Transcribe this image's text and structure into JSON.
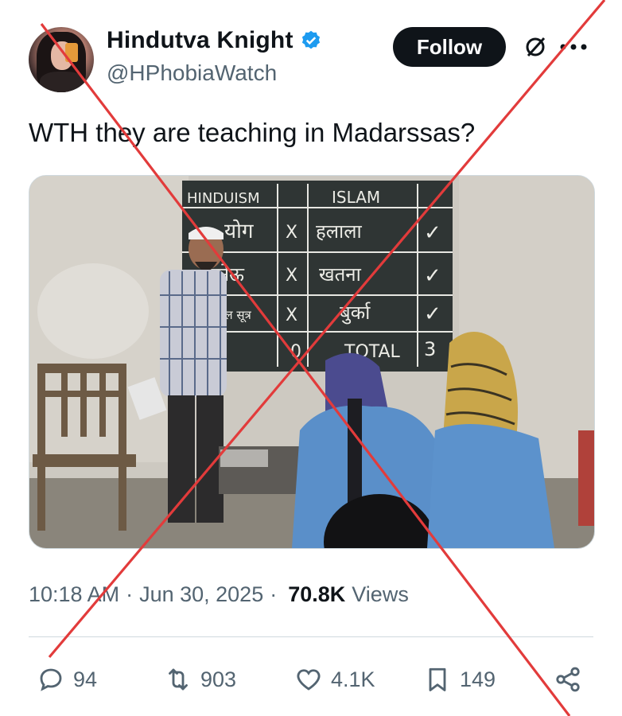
{
  "author": {
    "display_name": "Hindutva Knight",
    "handle": "@HPhobiaWatch",
    "verified": true,
    "verified_color": "#1d9bf0"
  },
  "header": {
    "follow_label": "Follow",
    "icons": [
      "grok-icon",
      "more-icon"
    ]
  },
  "tweet": {
    "text": "WTH they are teaching in Madarssas?"
  },
  "media": {
    "board": {
      "col_left": "HINDUISM",
      "col_right": "ISLAM",
      "rows": [
        {
          "left": "योग",
          "mark_left": "X",
          "right": "हलाला",
          "mark_right": "✓"
        },
        {
          "left": "जनेऊ",
          "mark_left": "X",
          "right": "खतना",
          "mark_right": "✓"
        },
        {
          "left": "मंगल सूत्र",
          "mark_left": "X",
          "right": "बुर्का",
          "mark_right": "✓"
        }
      ],
      "total_left": "0",
      "total_label": "TOTAL",
      "total_right": "3"
    }
  },
  "meta": {
    "time": "10:18 AM",
    "sep1": "·",
    "date": "Jun 30, 2025",
    "sep2": "·",
    "views_count": "70.8K",
    "views_label": "Views"
  },
  "actions": {
    "replies": "94",
    "reposts": "903",
    "likes": "4.1K",
    "bookmarks": "149"
  },
  "overlay": {
    "cross_color": "#e23b3b"
  }
}
